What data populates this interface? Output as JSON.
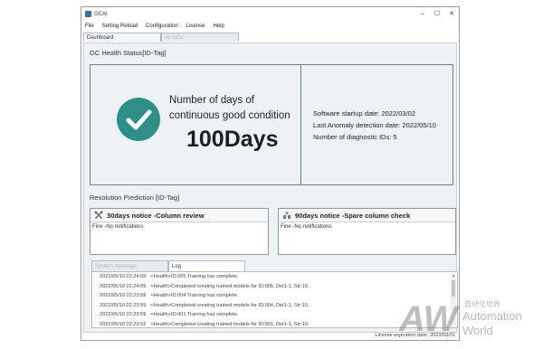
{
  "window": {
    "title": "GCAI",
    "minimize": "–",
    "maximize": "☐",
    "close": "✕"
  },
  "menu": [
    "File",
    "Setting Reload",
    "Configuration",
    "License",
    "Help"
  ],
  "tabs": [
    {
      "label": "Dashboard"
    },
    {
      "label": "All GCs"
    }
  ],
  "health": {
    "section_title": "GC Health Status[ID-Tag]",
    "caption_line1": "Number of days of",
    "caption_line2": "continuous good condition",
    "days_value": "100Days",
    "startup_date": "Software startup date: 2022/03/02",
    "last_anomaly": "Last Anomaly detection date: 2022/05/10",
    "diag_ids": "Number of diagnostic IDs: 5"
  },
  "prediction": {
    "section_title": "Resolution Prediction [ID-Tag]",
    "notice30_title": "30days notice -Column review",
    "notice30_body": "Fine -No notifications",
    "notice90_title": "90days notice -Spare column check",
    "notice90_body": "Fine -No notifications"
  },
  "log": {
    "tab_system": "System message",
    "tab_log": "Log",
    "lines": [
      {
        "ts": "2022/05/10 22:24:09",
        "msg": "<Health>ID:005 Training has complete."
      },
      {
        "ts": "2022/05/10 22:24:09",
        "msg": "<Health>Completed creating trained models for ID:005, Det1-1, Str:10."
      },
      {
        "ts": "2022/05/10 22:23:59",
        "msg": "<Health>ID:004 Training has complete."
      },
      {
        "ts": "2022/05/10 22:23:59",
        "msg": "<Health>Completed creating trained models for ID:004, Det1-1, Str:10."
      },
      {
        "ts": "2022/05/10 22:23:59",
        "msg": "<Health>ID:001 Training has complete."
      },
      {
        "ts": "2022/05/10 22:23:52",
        "msg": "<Health>Completed creating trained models for ID:001, Det1-1, Str:10."
      }
    ]
  },
  "status": {
    "license": "License expiration date: 2023/03/31"
  },
  "watermark": {
    "logo": "AW",
    "cn": "自动化世界",
    "line1": "Automation",
    "line2": "World"
  },
  "colors": {
    "accent": "#2e8f87",
    "panel": "#edf2f4",
    "border": "#6b8087"
  },
  "icons": {
    "health": "check-circle-icon",
    "notice30": "tools-icon",
    "notice90": "columns-icon"
  }
}
